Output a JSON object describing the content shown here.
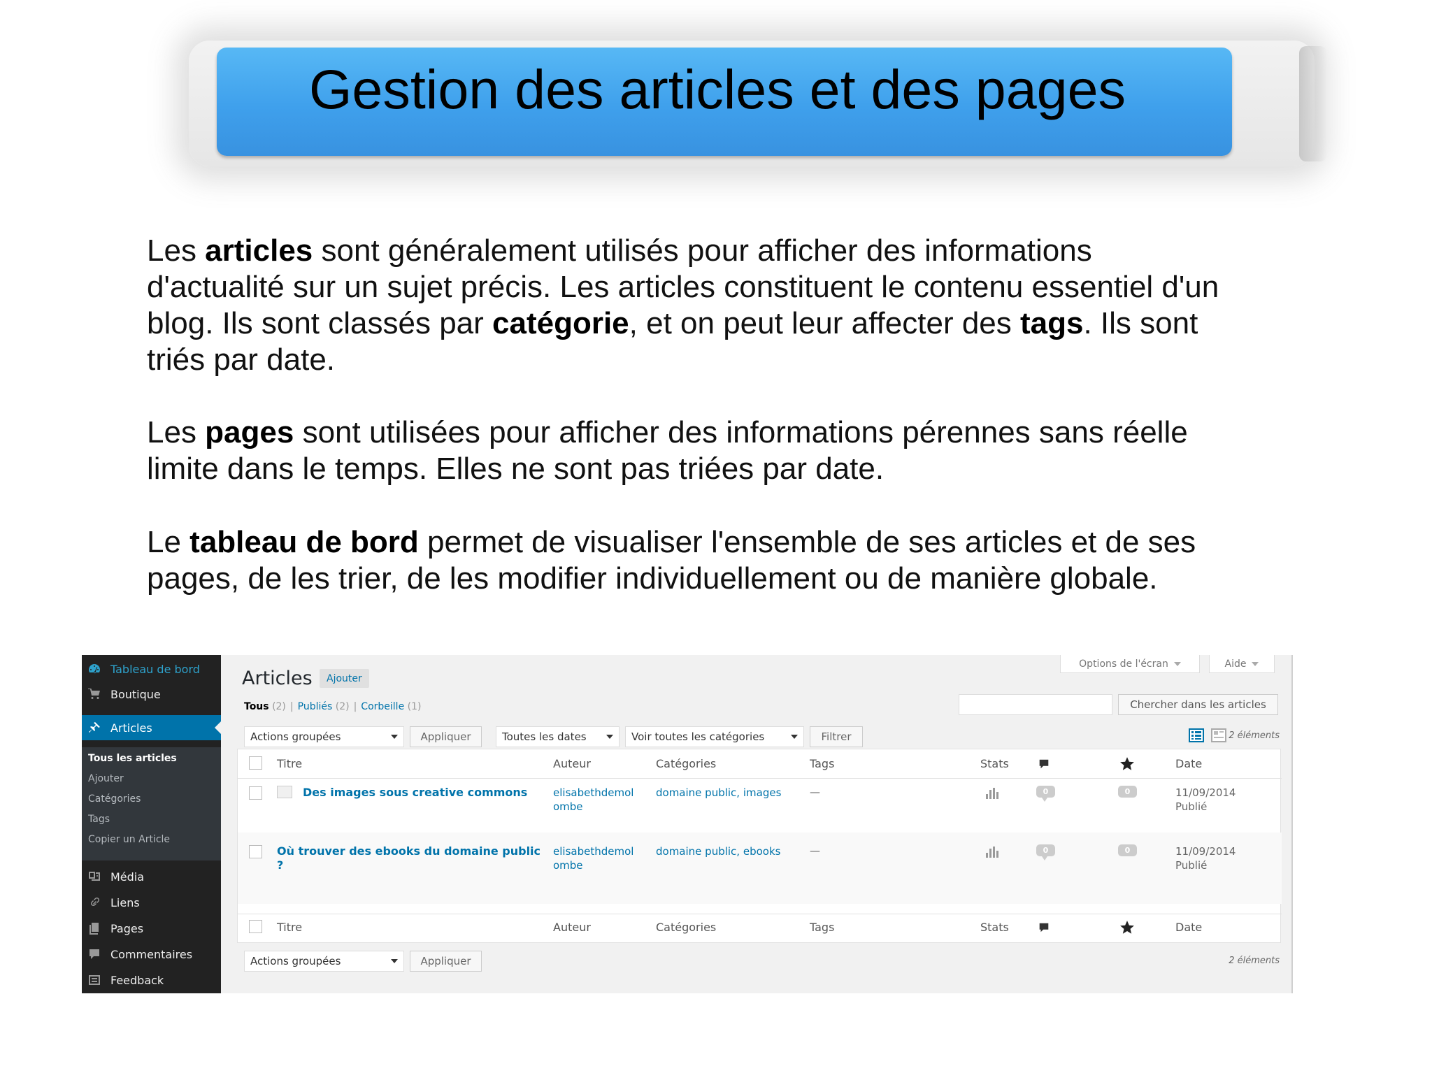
{
  "slide": {
    "title": "Gestion des articles et des pages",
    "paragraphs": {
      "p1": {
        "t1": "Les ",
        "b1": "articles",
        "t2": " sont généralement utilisés pour afficher des informations d'actualité sur un sujet précis. Les articles constituent le contenu essentiel d'un blog. Ils sont classés par ",
        "b2": "catégorie",
        "t3": ", et on peut leur affecter des ",
        "b3": "tags",
        "t4": ". Ils sont triés par date."
      },
      "p2": {
        "t1": "Les ",
        "b1": "pages",
        "t2": " sont utilisées pour afficher des informations pérennes sans réelle limite dans le temps. Elles ne sont pas triées par date."
      },
      "p3": {
        "t1": "Le ",
        "b1": "tableau de bord",
        "t2": " permet de visualiser l'ensemble de ses articles et de ses pages, de les trier, de les modifier individuellement ou de manière globale."
      }
    }
  },
  "wp": {
    "sidebar": {
      "dashboard": "Tableau de bord",
      "shop": "Boutique",
      "articles": "Articles",
      "submenu": [
        "Tous les articles",
        "Ajouter",
        "Catégories",
        "Tags",
        "Copier un Article"
      ],
      "media": "Média",
      "links": "Liens",
      "pages": "Pages",
      "comments": "Commentaires",
      "feedback": "Feedback"
    },
    "screen_options": "Options de l'écran",
    "help": "Aide",
    "heading": "Articles",
    "add_button": "Ajouter",
    "filters": {
      "all": "Tous",
      "all_count": "(2)",
      "published": "Publiés",
      "published_count": "(2)",
      "trash": "Corbeille",
      "trash_count": "(1)",
      "separator": "|"
    },
    "search_button": "Chercher dans les articles",
    "bulk_actions": "Actions groupées",
    "apply": "Appliquer",
    "all_dates": "Toutes les dates",
    "all_categories": "Voir toutes les catégories",
    "filter_button": "Filtrer",
    "item_count": "2 éléments",
    "columns": {
      "title": "Titre",
      "author": "Auteur",
      "categories": "Catégories",
      "tags": "Tags",
      "stats": "Stats",
      "date": "Date"
    },
    "rows": [
      {
        "title": "Des images sous creative commons",
        "author_l1": "elisabethdemol",
        "author_l2": "ombe",
        "categories": "domaine public, images",
        "tags": "—",
        "comments": "0",
        "likes": "0",
        "date": "11/09/2014",
        "status": "Publié"
      },
      {
        "title_l1": "Où trouver des ebooks du domaine public",
        "title_l2": "?",
        "author_l1": "elisabethdemol",
        "author_l2": "ombe",
        "categories": "domaine public, ebooks",
        "tags": "—",
        "comments": "0",
        "likes": "0",
        "date": "11/09/2014",
        "status": "Publié"
      }
    ]
  }
}
